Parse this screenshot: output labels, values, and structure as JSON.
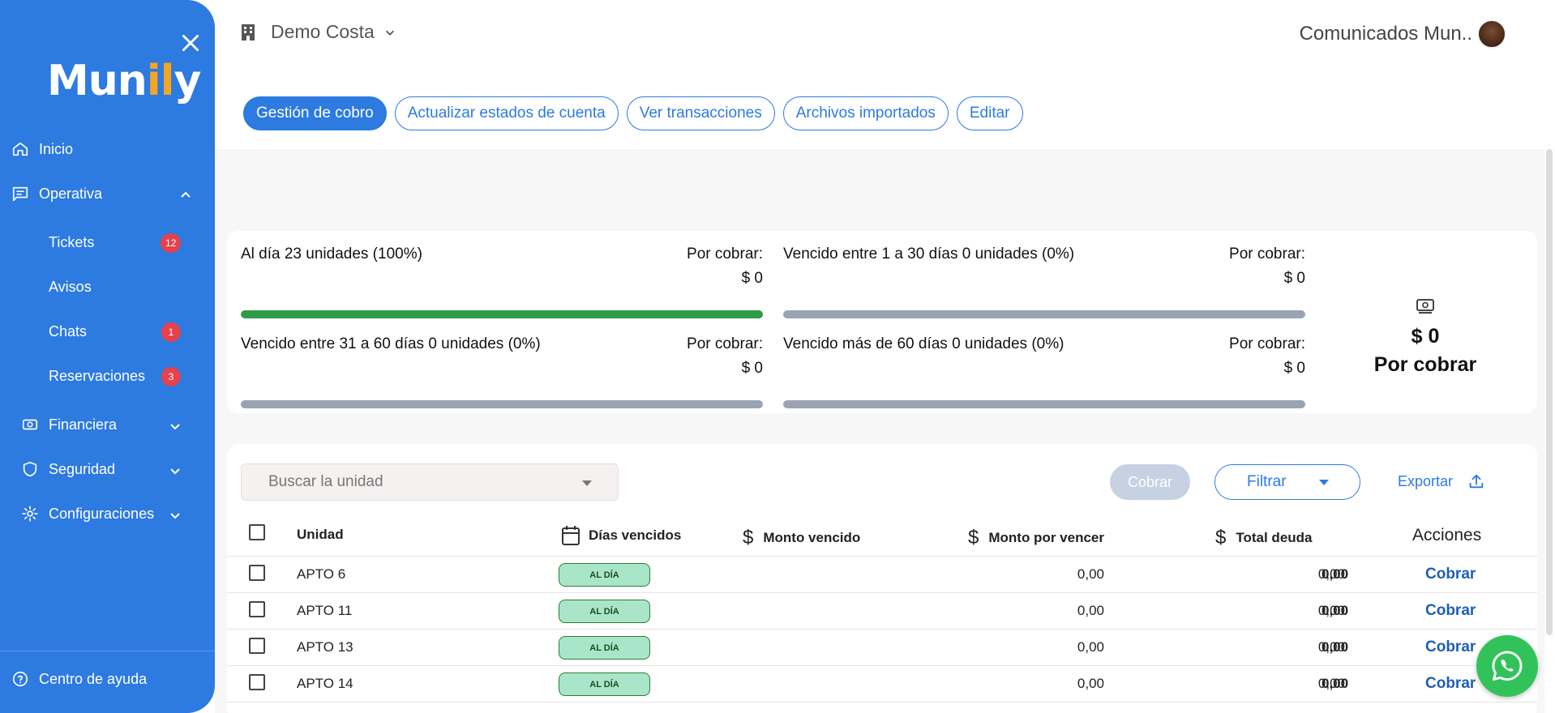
{
  "sidebar": {
    "logo": "Munily",
    "items": [
      {
        "label": "Inicio"
      },
      {
        "label": "Operativa"
      },
      {
        "label": "Tickets",
        "badge": "12"
      },
      {
        "label": "Avisos"
      },
      {
        "label": "Chats",
        "badge": "1"
      },
      {
        "label": "Reservaciones",
        "badge": "3"
      },
      {
        "label": "Financiera"
      },
      {
        "label": "Seguridad"
      },
      {
        "label": "Configuraciones"
      }
    ],
    "help": "Centro de ayuda"
  },
  "header": {
    "org": "Demo Costa",
    "user": "Comunicados Mun.."
  },
  "tabs": [
    {
      "label": "Gestión de cobro",
      "active": true
    },
    {
      "label": "Actualizar estados de cuenta"
    },
    {
      "label": "Ver transacciones"
    },
    {
      "label": "Archivos importados"
    },
    {
      "label": "Editar"
    }
  ],
  "summary": {
    "metrics": [
      {
        "label": "Al día 23 unidades (100%)",
        "por_cobrar": "Por cobrar:",
        "amount": "$ 0",
        "fill_percent": 100
      },
      {
        "label": "Vencido entre 1 a 30 días 0 unidades (0%)",
        "por_cobrar": "Por cobrar:",
        "amount": "$ 0",
        "fill_percent": 0
      },
      {
        "label": "Vencido entre 31 a 60 días 0 unidades (0%)",
        "por_cobrar": "Por cobrar:",
        "amount": "$ 0",
        "fill_percent": 0
      },
      {
        "label": "Vencido más de 60 días 0 unidades (0%)",
        "por_cobrar": "Por cobrar:",
        "amount": "$ 0",
        "fill_percent": 0
      }
    ],
    "total_value": "$ 0",
    "total_caption": "Por cobrar"
  },
  "toolbar": {
    "search_placeholder": "Buscar la unidad",
    "cobrar": "Cobrar",
    "filtrar": "Filtrar",
    "exportar": "Exportar"
  },
  "table": {
    "headers": {
      "unidad": "Unidad",
      "dias": "Días vencidos",
      "monto_vencido": "Monto vencido",
      "monto_por_vencer": "Monto por vencer",
      "total": "Total deuda",
      "acciones": "Acciones"
    },
    "rows": [
      {
        "unidad": "APTO 6",
        "estado": "AL DÍA",
        "monto_vencido": "0,00",
        "monto_por_vencer": "0,00",
        "total": "0,00",
        "accion": "Cobrar"
      },
      {
        "unidad": "APTO 11",
        "estado": "AL DÍA",
        "monto_vencido": "0,00",
        "monto_por_vencer": "0,00",
        "total": "0,00",
        "accion": "Cobrar"
      },
      {
        "unidad": "APTO 13",
        "estado": "AL DÍA",
        "monto_vencido": "0,00",
        "monto_por_vencer": "0,00",
        "total": "0,00",
        "accion": "Cobrar"
      },
      {
        "unidad": "APTO 14",
        "estado": "AL DÍA",
        "monto_vencido": "0,00",
        "monto_por_vencer": "0,00",
        "total": "0,00",
        "accion": "Cobrar"
      }
    ]
  },
  "colors": {
    "primary": "#2d7ae0",
    "success_bar": "#2e9b48",
    "neutral_bar": "#99a3b3",
    "badge": "#e4424d",
    "pill_bg": "#a9e6c9",
    "whatsapp": "#31c35a"
  }
}
